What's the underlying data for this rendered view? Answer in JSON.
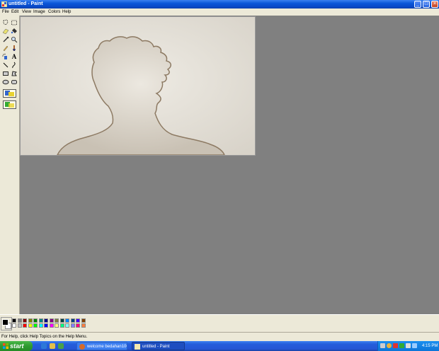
{
  "window": {
    "title": "untitled - Paint",
    "minimize_glyph": "_",
    "maximize_glyph": "□",
    "close_glyph": "×"
  },
  "menu": {
    "items": [
      "File",
      "Edit",
      "View",
      "Image",
      "Colors",
      "Help"
    ]
  },
  "toolbox": {
    "tools": [
      {
        "name": "free-form-select-icon"
      },
      {
        "name": "rectangle-select-icon"
      },
      {
        "name": "eraser-icon"
      },
      {
        "name": "fill-bucket-icon"
      },
      {
        "name": "color-picker-icon"
      },
      {
        "name": "magnifier-icon"
      },
      {
        "name": "pencil-icon"
      },
      {
        "name": "brush-icon"
      },
      {
        "name": "airbrush-icon"
      },
      {
        "name": "text-icon"
      },
      {
        "name": "line-icon"
      },
      {
        "name": "curve-icon"
      },
      {
        "name": "rectangle-icon"
      },
      {
        "name": "polygon-icon"
      },
      {
        "name": "ellipse-icon"
      },
      {
        "name": "rounded-rectangle-icon"
      }
    ],
    "text_tool_glyph": "A"
  },
  "palette": {
    "foreground": "#000000",
    "background": "#ffffff",
    "row1": [
      "#000000",
      "#808080",
      "#800000",
      "#808000",
      "#008000",
      "#008080",
      "#000080",
      "#800080",
      "#808040",
      "#004040",
      "#0080ff",
      "#004080",
      "#4000ff",
      "#804000"
    ],
    "row2": [
      "#ffffff",
      "#c0c0c0",
      "#ff0000",
      "#ffff00",
      "#00ff00",
      "#00ffff",
      "#0000ff",
      "#ff00ff",
      "#ffff80",
      "#00ff80",
      "#80ffff",
      "#8080ff",
      "#ff0080",
      "#ff8040"
    ]
  },
  "status": {
    "text": "For Help, click Help Topics on the Help Menu."
  },
  "taskbar": {
    "start_label": "start",
    "tasks": [
      {
        "label": "welcome bedahan100",
        "active": false
      },
      {
        "label": "untitled - Paint",
        "active": true
      }
    ],
    "clock": "4:15 PM"
  }
}
